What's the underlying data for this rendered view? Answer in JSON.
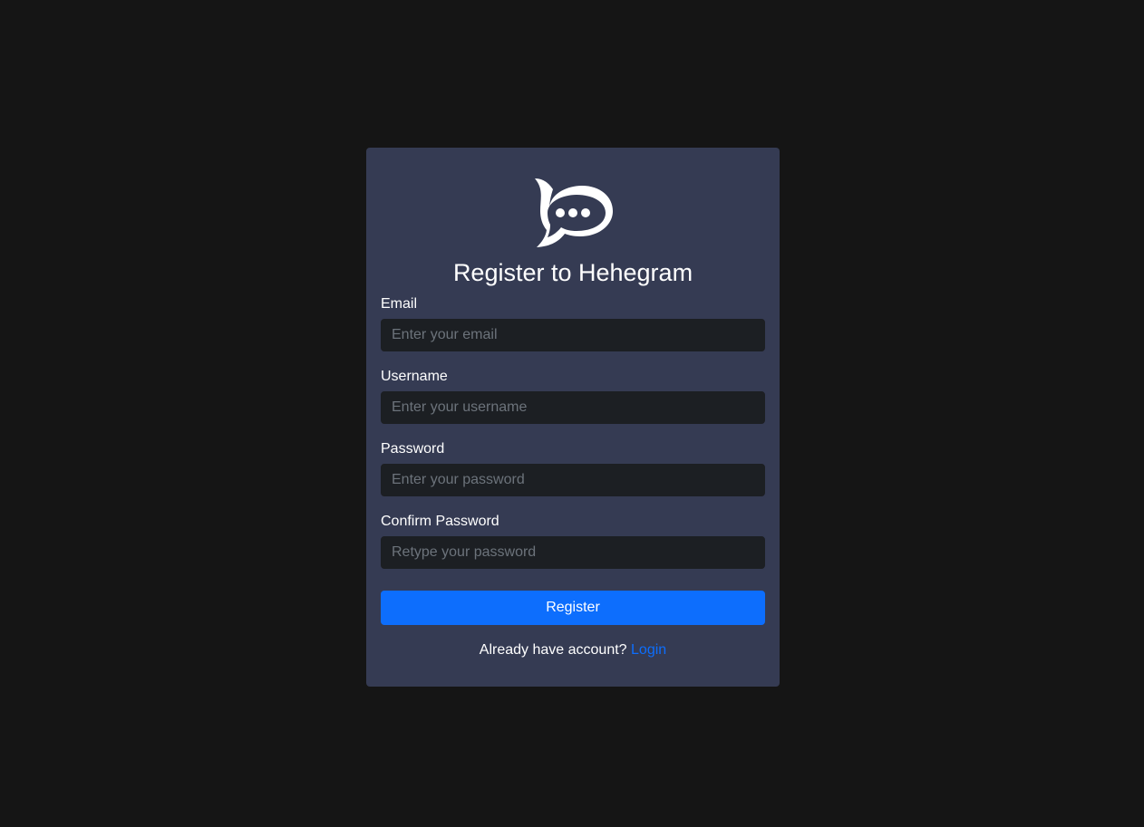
{
  "form": {
    "title": "Register to Hehegram",
    "logo_icon": "chat-bubble-icon",
    "fields": [
      {
        "label": "Email",
        "placeholder": "Enter your email",
        "value": ""
      },
      {
        "label": "Username",
        "placeholder": "Enter your username",
        "value": ""
      },
      {
        "label": "Password",
        "placeholder": "Enter your password",
        "value": ""
      },
      {
        "label": "Confirm Password",
        "placeholder": "Retype your password",
        "value": ""
      }
    ],
    "submit_label": "Register",
    "footer_prompt": "Already have account?",
    "login_link_label": "Login"
  },
  "colors": {
    "page_background": "#151515",
    "card_background": "#353b53",
    "input_background": "#1c1f23",
    "accent": "#0d6efd",
    "text": "#ffffff",
    "placeholder": "#6c737b"
  }
}
